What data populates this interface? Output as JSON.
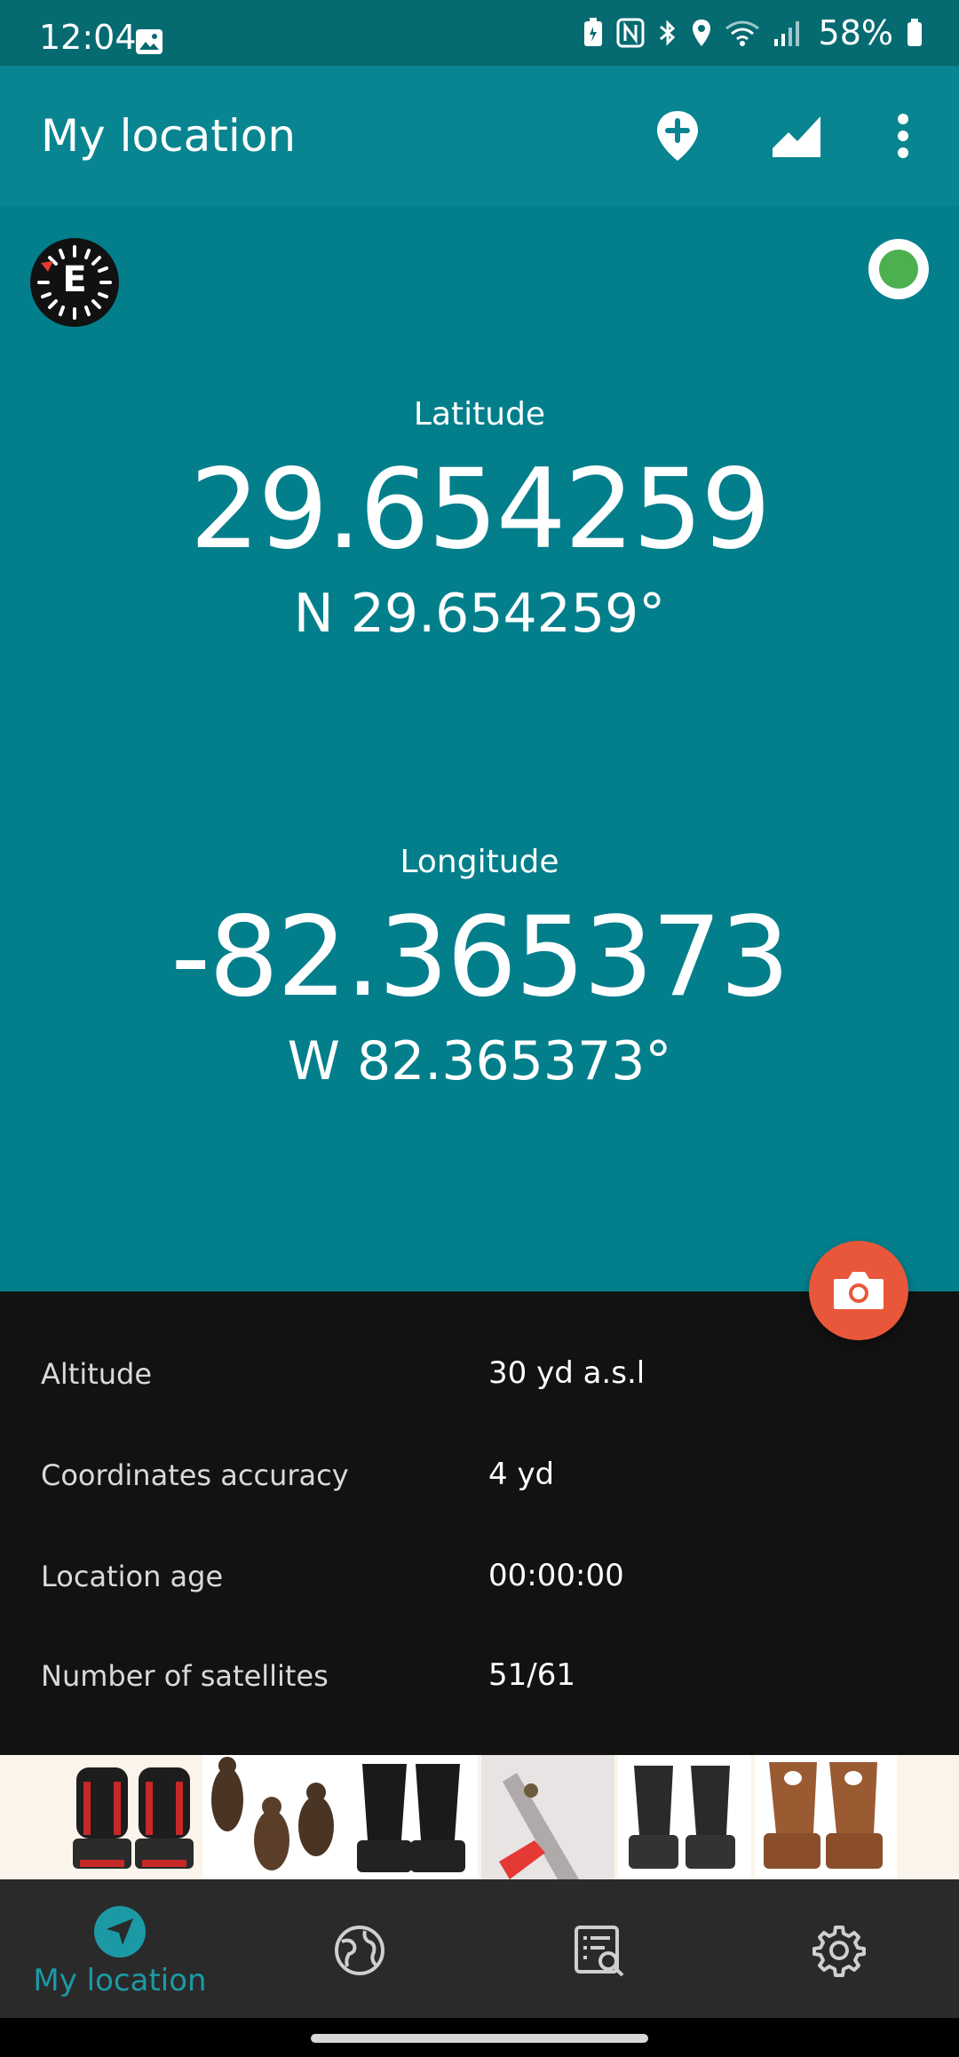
{
  "status_bar": {
    "time": "12:04",
    "battery": "58%"
  },
  "app_bar": {
    "title": "My location",
    "actions": [
      "add-location-icon",
      "elevation-chart-icon",
      "more-vert-icon"
    ]
  },
  "compass": {
    "heading_letter": "E"
  },
  "latitude": {
    "label": "Latitude",
    "value": "29.654259",
    "dms": "N 29.654259°"
  },
  "longitude": {
    "label": "Longitude",
    "value": "-82.365373",
    "dms": "W 82.365373°"
  },
  "info": [
    {
      "label": "Altitude",
      "value": "30 yd a.s.l"
    },
    {
      "label": "Coordinates accuracy",
      "value": "4 yd"
    },
    {
      "label": "Location age",
      "value": "00:00:00"
    },
    {
      "label": "Number of satellites",
      "value": "51/61"
    }
  ],
  "bottom_nav": {
    "items": [
      {
        "label": "My location",
        "icon": "navigation-arrow-icon",
        "active": true
      },
      {
        "label": "",
        "icon": "globe-icon",
        "active": false
      },
      {
        "label": "",
        "icon": "list-search-icon",
        "active": false
      },
      {
        "label": "",
        "icon": "gear-icon",
        "active": false
      }
    ]
  },
  "colors": {
    "status_bar": "#066a71",
    "app_bar": "#088590",
    "main_panel": "#037f8c",
    "fab": "#e8573a",
    "accent": "#1b9aa6",
    "gps_ok": "#4caf50"
  }
}
